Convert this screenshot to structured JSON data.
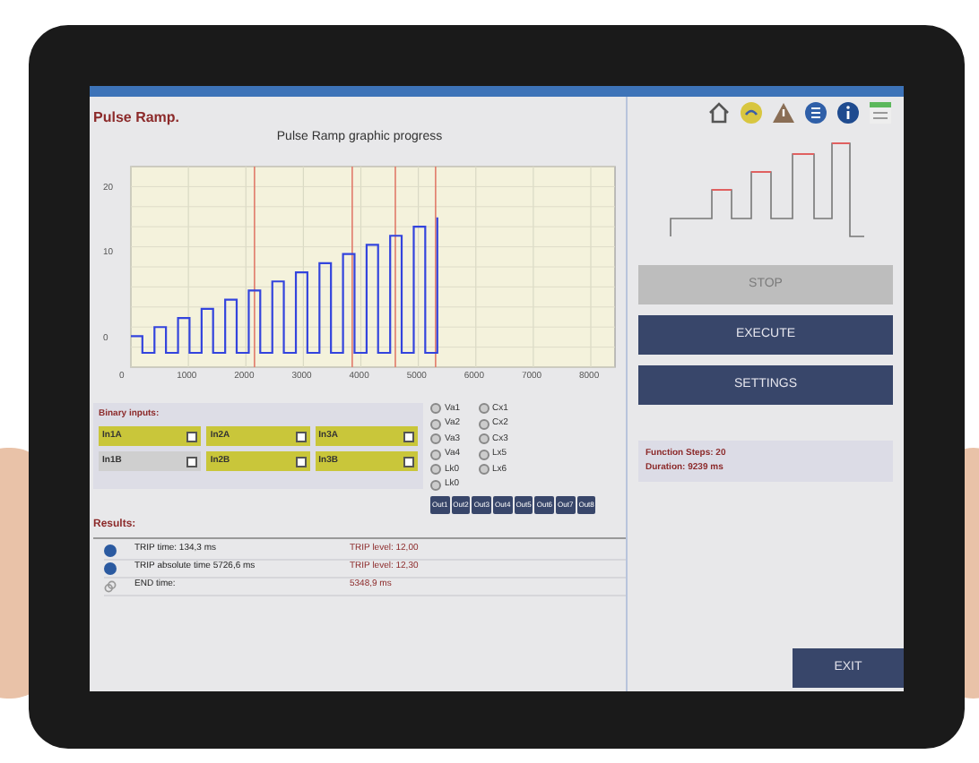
{
  "header": {
    "title": "Pulse Ramp.",
    "toolbar": [
      {
        "kind": "home"
      },
      {
        "kind": "gauge"
      },
      {
        "kind": "warning"
      },
      {
        "kind": "list"
      },
      {
        "kind": "info"
      },
      {
        "kind": "menu"
      }
    ]
  },
  "graph": {
    "title": "Pulse Ramp graphic progress",
    "x_ticks": [
      "0",
      "1000",
      "2000",
      "3000",
      "4000",
      "5000",
      "6000",
      "7000",
      "8000"
    ],
    "y_ticks": [
      "20",
      "10",
      "0"
    ]
  },
  "binary_inputs": {
    "title": "Binary inputs:",
    "items": [
      {
        "label": "In1A",
        "on": true
      },
      {
        "label": "In2A",
        "on": true
      },
      {
        "label": "In3A",
        "on": true
      },
      {
        "label": "In1B",
        "on": false
      },
      {
        "label": "In2B",
        "on": true
      },
      {
        "label": "In3B",
        "on": true
      }
    ]
  },
  "analog_column_1": [
    "Va1",
    "Va2",
    "Va3",
    "Va4",
    "Lk0",
    "Lk0"
  ],
  "analog_column_2": [
    "Cx1",
    "Cx2",
    "Cx3",
    "Lx5",
    "Lx6"
  ],
  "outputs": [
    "Out1",
    "Out2",
    "Out3",
    "Out4",
    "Out5",
    "Out6",
    "Out7",
    "Out8"
  ],
  "results": {
    "title": "Results:",
    "rows": [
      {
        "kind": "info",
        "text": "TRIP time: 134,3 ms",
        "value": "TRIP level: 12,00"
      },
      {
        "kind": "info",
        "text": "TRIP absolute time 5726,6 ms",
        "value": "TRIP level: 12,30"
      },
      {
        "kind": "link",
        "text": "END time:",
        "value": "5348,9 ms"
      }
    ]
  },
  "controls": [
    {
      "label": "STOP",
      "disabled": true
    },
    {
      "label": "EXECUTE",
      "disabled": false
    },
    {
      "label": "SETTINGS",
      "disabled": false
    }
  ],
  "summary": [
    "Function Steps: 20",
    "Duration: 9239 ms"
  ],
  "exit_button": "EXIT"
}
